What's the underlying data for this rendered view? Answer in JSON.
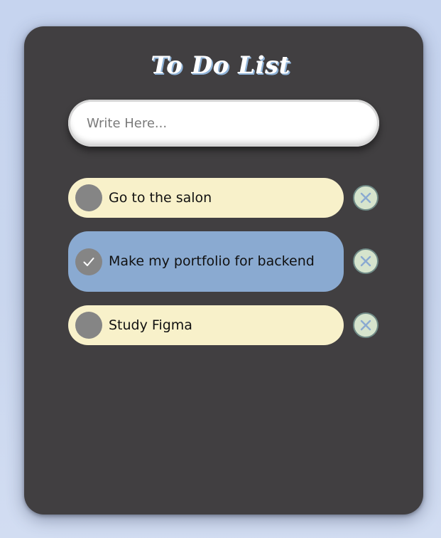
{
  "app": {
    "title": "To Do List"
  },
  "input": {
    "placeholder": "Write Here...",
    "value": ""
  },
  "todos": [
    {
      "text": "Go to the salon",
      "checked": false
    },
    {
      "text": "Make my portfolio for backend",
      "checked": true
    },
    {
      "text": "Study Figma",
      "checked": false
    }
  ],
  "icons": {
    "check": "check-icon",
    "delete": "close-icon"
  },
  "colors": {
    "page_background": "#c9d6ee",
    "card_background": "#413f41",
    "todo_pending": "#f8f1ca",
    "todo_done": "#8aaad1",
    "check_circle": "#858585",
    "delete_button": "#d6e4cd",
    "delete_icon": "#8aaad1"
  }
}
